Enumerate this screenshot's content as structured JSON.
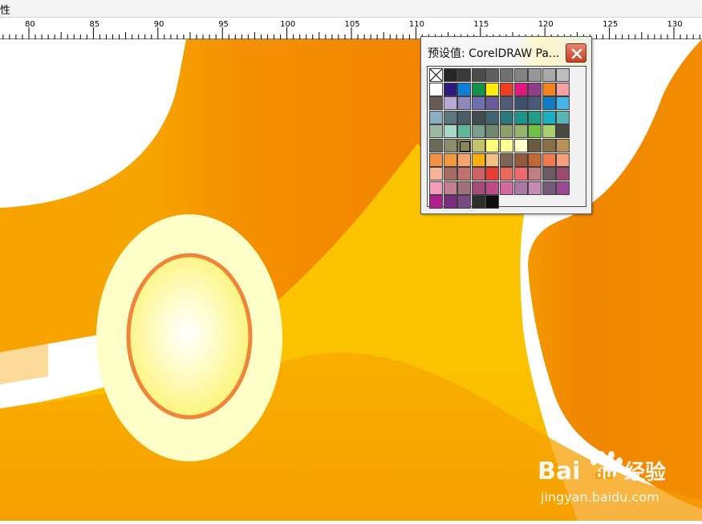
{
  "topbar": {
    "label": "性"
  },
  "ruler": {
    "labels": [
      "80",
      "85",
      "90",
      "95",
      "100",
      "105",
      "110",
      "115",
      "120",
      "125",
      "130"
    ]
  },
  "palette": {
    "title": "预设值: CorelDRAW Pa...",
    "close_icon": "close-icon",
    "none_swatch_icon": "no-color-icon",
    "selected_index": 52,
    "swatches": [
      "none",
      "#262626",
      "#3a3a3a",
      "#4c4c4c",
      "#5e5e5e",
      "#717171",
      "#838383",
      "#979797",
      "#aaaaaa",
      "#bdbdbd",
      "#ffffff",
      "#2e1a7a",
      "#0e7fd7",
      "#12924a",
      "#fcec0b",
      "#ed3f22",
      "#e0177c",
      "#8f3d86",
      "#f58220",
      "#f7a0a3",
      "#6b5b58",
      "#b8a8d2",
      "#8f88bc",
      "#6f6fb0",
      "#6a5a9c",
      "#525a7a",
      "#3f4e6e",
      "#4c5a7a",
      "#0f7cc4",
      "#46b4e6",
      "#8aaebe",
      "#5e7880",
      "#4c5c64",
      "#424c4e",
      "#3f6670",
      "#2a7a7c",
      "#1e938c",
      "#1f9d86",
      "#19b0c4",
      "#59b6b4",
      "#9ab8a2",
      "#a8d8c6",
      "#5fb89a",
      "#7a9e8e",
      "#708a6e",
      "#8ea06a",
      "#96b46e",
      "#70c046",
      "#a8d270",
      "#4a4a40",
      "#6a6a58",
      "#8a8c6c",
      "#8c8654",
      "#c4c268",
      "#fefc78",
      "#fefe92",
      "#fefec8",
      "#6a5a3e",
      "#8a6e44",
      "#b89058",
      "#f39244",
      "#f4983e",
      "#f5a46e",
      "#f7b00e",
      "#f2c083",
      "#7e6656",
      "#945a3e",
      "#c26834",
      "#f17a50",
      "#f59e7a",
      "#f4b39a",
      "#a66a64",
      "#c2726c",
      "#ce6066",
      "#e83c34",
      "#ec6a5a",
      "#f0686c",
      "#c27e80",
      "#6e5a66",
      "#9c4a70",
      "#f49cbc",
      "#c48092",
      "#a0707e",
      "#a84a78",
      "#be4c84",
      "#d668a0",
      "#a87aa0",
      "#c48ab4",
      "#725a78",
      "#9a4a92",
      "#b0208a",
      "#7a2e7e",
      "#7a4a82",
      "#2e2e2e",
      "#0e0e0e"
    ]
  }
}
